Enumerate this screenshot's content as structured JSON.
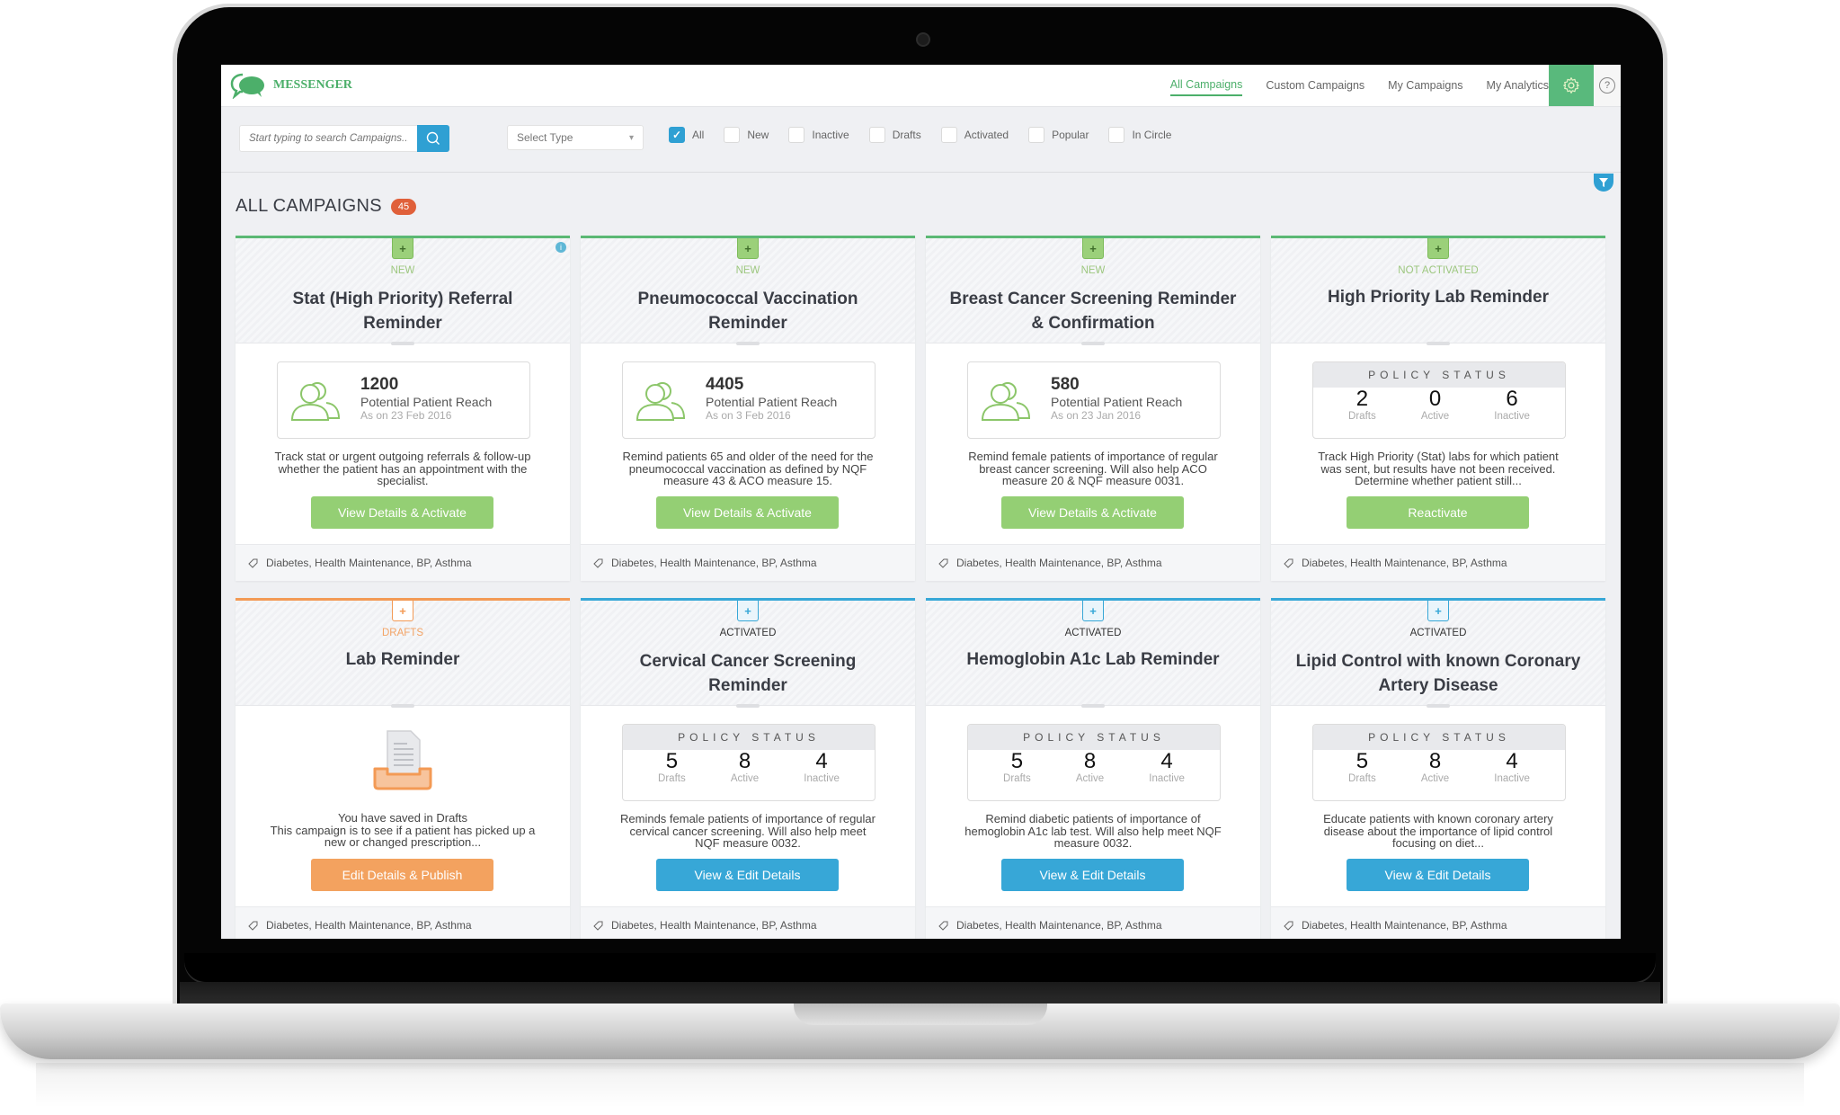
{
  "app": {
    "name": "MESSENGER"
  },
  "nav": {
    "items": [
      {
        "label": "All Campaigns",
        "active": true
      },
      {
        "label": "Custom Campaigns",
        "active": false
      },
      {
        "label": "My Campaigns",
        "active": false
      },
      {
        "label": "My Analytics",
        "active": false
      }
    ],
    "settings_icon": "gear-icon",
    "help_icon": "question-circle-icon",
    "help_glyph": "?"
  },
  "filters": {
    "search_placeholder": "Start typing to search Campaigns...",
    "select_type": "Select Type",
    "select_arrow": "▾",
    "checkboxes": [
      {
        "label": "All",
        "checked": true
      },
      {
        "label": "New",
        "checked": false
      },
      {
        "label": "Inactive",
        "checked": false
      },
      {
        "label": "Drafts",
        "checked": false
      },
      {
        "label": "Activated",
        "checked": false
      },
      {
        "label": "Popular",
        "checked": false
      },
      {
        "label": "In Circle",
        "checked": false
      }
    ],
    "check_glyph": "✓"
  },
  "page": {
    "title": "ALL CAMPAIGNS",
    "count": "45"
  },
  "policy_labels": {
    "header": "POLICY STATUS",
    "drafts": "Drafts",
    "active": "Active",
    "inactive": "Inactive"
  },
  "reach_label": "Potential Patient Reach",
  "ribbon_glyph": "+",
  "info_glyph": "i",
  "campaigns": [
    {
      "status": "NEW",
      "title": "Stat (High Priority) Referral Reminder",
      "reach": "1200",
      "reach_date": "As on 23 Feb 2016",
      "description": "Track stat or urgent outgoing referrals & follow-up whether the patient has an appointment with the specialist.",
      "button": "View Details & Activate",
      "tags": "Diabetes, Health Maintenance, BP, Asthma"
    },
    {
      "status": "NEW",
      "title": "Pneumococcal Vaccination Reminder",
      "reach": "4405",
      "reach_date": "As on 3 Feb 2016",
      "description": "Remind patients 65 and older of the need for the pneumococcal vaccination as defined by NQF measure 43 & ACO measure 15.",
      "button": "View Details & Activate",
      "tags": "Diabetes, Health Maintenance, BP, Asthma"
    },
    {
      "status": "NEW",
      "title": "Breast Cancer Screening Reminder & Confirmation",
      "reach": "580",
      "reach_date": "As on 23 Jan 2016",
      "description": "Remind female patients of importance of regular breast cancer screening. Will also help ACO measure 20 & NQF measure 0031.",
      "button": "View Details & Activate",
      "tags": "Diabetes, Health Maintenance, BP, Asthma"
    },
    {
      "status": "NOT ACTIVATED",
      "title": "High Priority Lab Reminder",
      "policy": {
        "drafts": "2",
        "active": "0",
        "inactive": "6"
      },
      "description": "Track High Priority (Stat) labs for which patient was sent, but results have not been received. Determine whether patient still...",
      "button": "Reactivate",
      "tags": "Diabetes, Health Maintenance, BP, Asthma"
    },
    {
      "status": "DRAFTS",
      "title": "Lab Reminder",
      "draft_line1": "You have saved in Drafts",
      "description": "This campaign is to see if a patient has picked up a new or changed prescription...",
      "button": "Edit Details & Publish",
      "tags": "Diabetes, Health Maintenance, BP, Asthma"
    },
    {
      "status": "ACTIVATED",
      "title": "Cervical Cancer Screening Reminder",
      "policy": {
        "drafts": "5",
        "active": "8",
        "inactive": "4"
      },
      "description": "Reminds female patients of importance of regular cervical cancer screening. Will also help meet NQF measure 0032.",
      "button": "View & Edit Details",
      "tags": "Diabetes, Health Maintenance, BP, Asthma"
    },
    {
      "status": "ACTIVATED",
      "title": "Hemoglobin A1c Lab Reminder",
      "policy": {
        "drafts": "5",
        "active": "8",
        "inactive": "4"
      },
      "description": "Remind diabetic patients of importance of hemoglobin A1c lab test. Will also help meet NQF measure 0032.",
      "button": "View & Edit Details",
      "tags": "Diabetes, Health Maintenance, BP, Asthma"
    },
    {
      "status": "ACTIVATED",
      "title": "Lipid Control with known Coronary Artery Disease",
      "policy": {
        "drafts": "5",
        "active": "8",
        "inactive": "4"
      },
      "description": "Educate patients with known coronary artery disease about the importance of lipid control focusing on diet...",
      "button": "View & Edit Details",
      "tags": "Diabetes, Health Maintenance, BP, Asthma"
    }
  ],
  "colors": {
    "brand_green": "#59b97c",
    "new_green": "#94cf74",
    "draft_orange": "#f3a25f",
    "active_blue": "#37a7d7",
    "count_badge": "#e0603a"
  }
}
